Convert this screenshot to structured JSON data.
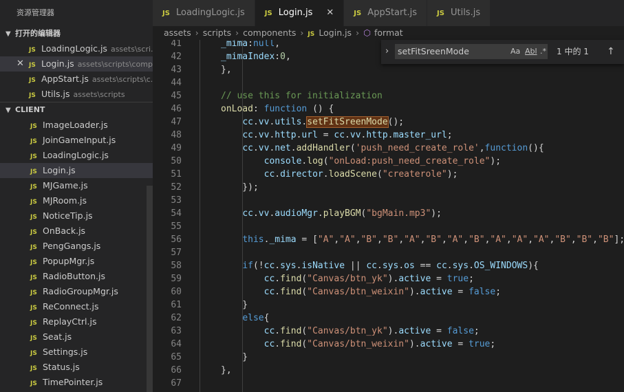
{
  "sidebar": {
    "title": "资源管理器",
    "open_editors_title": "打开的编辑器",
    "open_editors": [
      {
        "name": "LoadingLogic.js",
        "path": "assets\\scri...",
        "selected": false,
        "close": false
      },
      {
        "name": "Login.js",
        "path": "assets\\scripts\\comp...",
        "selected": true,
        "close": true
      },
      {
        "name": "AppStart.js",
        "path": "assets\\scripts\\c...",
        "selected": false,
        "close": false
      },
      {
        "name": "Utils.js",
        "path": "assets\\scripts",
        "selected": false,
        "close": false
      }
    ],
    "client_title": "CLIENT",
    "files": [
      "ImageLoader.js",
      "JoinGameInput.js",
      "LoadingLogic.js",
      "Login.js",
      "MJGame.js",
      "MJRoom.js",
      "NoticeTip.js",
      "OnBack.js",
      "PengGangs.js",
      "PopupMgr.js",
      "RadioButton.js",
      "RadioGroupMgr.js",
      "ReConnect.js",
      "ReplayCtrl.js",
      "Seat.js",
      "Settings.js",
      "Status.js",
      "TimePointer.js"
    ],
    "selected_file": "Login.js"
  },
  "tabs": [
    {
      "label": "LoadingLogic.js",
      "active": false
    },
    {
      "label": "Login.js",
      "active": true
    },
    {
      "label": "AppStart.js",
      "active": false
    },
    {
      "label": "Utils.js",
      "active": false
    }
  ],
  "breadcrumb": {
    "parts": [
      "assets",
      "scripts",
      "components",
      "Login.js"
    ],
    "symbol": "format"
  },
  "find": {
    "query": "setFitSreenMode",
    "opt_case": "Aa",
    "opt_word": "Abl",
    "opt_regex": ".*",
    "count": "1 中的 1"
  },
  "code": {
    "lines": [
      {
        "n": "41",
        "t": [
          [
            "p",
            "_mima"
          ],
          [
            "d",
            ":"
          ],
          [
            "k",
            "null"
          ],
          [
            "d",
            ","
          ]
        ]
      },
      {
        "n": "42",
        "t": [
          [
            "p",
            "_mimaIndex"
          ],
          [
            "d",
            ":"
          ],
          [
            "n",
            "0"
          ],
          [
            "d",
            ","
          ]
        ]
      },
      {
        "n": "43",
        "t": [
          [
            "d",
            "},"
          ]
        ]
      },
      {
        "n": "44",
        "t": []
      },
      {
        "n": "45",
        "t": [
          [
            "c",
            "// use this for initialization"
          ]
        ]
      },
      {
        "n": "46",
        "t": [
          [
            "f",
            "onLoad"
          ],
          [
            "d",
            ": "
          ],
          [
            "k",
            "function"
          ],
          [
            "d",
            " () {"
          ]
        ]
      },
      {
        "n": "47",
        "t": [
          [
            "d",
            "    "
          ],
          [
            "p",
            "cc"
          ],
          [
            "d",
            "."
          ],
          [
            "p",
            "vv"
          ],
          [
            "d",
            "."
          ],
          [
            "p",
            "utils"
          ],
          [
            "d",
            "."
          ],
          [
            "h",
            "setFitSreenMode"
          ],
          [
            "d",
            "();"
          ]
        ]
      },
      {
        "n": "48",
        "t": [
          [
            "d",
            "    "
          ],
          [
            "p",
            "cc"
          ],
          [
            "d",
            "."
          ],
          [
            "p",
            "vv"
          ],
          [
            "d",
            "."
          ],
          [
            "p",
            "http"
          ],
          [
            "d",
            "."
          ],
          [
            "p",
            "url"
          ],
          [
            "d",
            " = "
          ],
          [
            "p",
            "cc"
          ],
          [
            "d",
            "."
          ],
          [
            "p",
            "vv"
          ],
          [
            "d",
            "."
          ],
          [
            "p",
            "http"
          ],
          [
            "d",
            "."
          ],
          [
            "p",
            "master_url"
          ],
          [
            "d",
            ";"
          ]
        ]
      },
      {
        "n": "49",
        "t": [
          [
            "d",
            "    "
          ],
          [
            "p",
            "cc"
          ],
          [
            "d",
            "."
          ],
          [
            "p",
            "vv"
          ],
          [
            "d",
            "."
          ],
          [
            "p",
            "net"
          ],
          [
            "d",
            "."
          ],
          [
            "f",
            "addHandler"
          ],
          [
            "d",
            "("
          ],
          [
            "s",
            "'push_need_create_role'"
          ],
          [
            "d",
            ","
          ],
          [
            "k",
            "function"
          ],
          [
            "d",
            "(){"
          ]
        ]
      },
      {
        "n": "50",
        "t": [
          [
            "d",
            "        "
          ],
          [
            "p",
            "console"
          ],
          [
            "d",
            "."
          ],
          [
            "f",
            "log"
          ],
          [
            "d",
            "("
          ],
          [
            "s",
            "\"onLoad:push_need_create_role\""
          ],
          [
            "d",
            ");"
          ]
        ]
      },
      {
        "n": "51",
        "t": [
          [
            "d",
            "        "
          ],
          [
            "p",
            "cc"
          ],
          [
            "d",
            "."
          ],
          [
            "p",
            "director"
          ],
          [
            "d",
            "."
          ],
          [
            "f",
            "loadScene"
          ],
          [
            "d",
            "("
          ],
          [
            "s",
            "\"createrole\""
          ],
          [
            "d",
            ");"
          ]
        ]
      },
      {
        "n": "52",
        "t": [
          [
            "d",
            "    });"
          ]
        ]
      },
      {
        "n": "53",
        "t": []
      },
      {
        "n": "54",
        "t": [
          [
            "d",
            "    "
          ],
          [
            "p",
            "cc"
          ],
          [
            "d",
            "."
          ],
          [
            "p",
            "vv"
          ],
          [
            "d",
            "."
          ],
          [
            "p",
            "audioMgr"
          ],
          [
            "d",
            "."
          ],
          [
            "f",
            "playBGM"
          ],
          [
            "d",
            "("
          ],
          [
            "s",
            "\"bgMain.mp3\""
          ],
          [
            "d",
            ");"
          ]
        ]
      },
      {
        "n": "55",
        "t": []
      },
      {
        "n": "56",
        "t": [
          [
            "d",
            "    "
          ],
          [
            "k",
            "this"
          ],
          [
            "d",
            "."
          ],
          [
            "p",
            "_mima"
          ],
          [
            "d",
            " = ["
          ],
          [
            "s",
            "\"A\""
          ],
          [
            "d",
            ","
          ],
          [
            "s",
            "\"A\""
          ],
          [
            "d",
            ","
          ],
          [
            "s",
            "\"B\""
          ],
          [
            "d",
            ","
          ],
          [
            "s",
            "\"B\""
          ],
          [
            "d",
            ","
          ],
          [
            "s",
            "\"A\""
          ],
          [
            "d",
            ","
          ],
          [
            "s",
            "\"B\""
          ],
          [
            "d",
            ","
          ],
          [
            "s",
            "\"A\""
          ],
          [
            "d",
            ","
          ],
          [
            "s",
            "\"B\""
          ],
          [
            "d",
            ","
          ],
          [
            "s",
            "\"A\""
          ],
          [
            "d",
            ","
          ],
          [
            "s",
            "\"A\""
          ],
          [
            "d",
            ","
          ],
          [
            "s",
            "\"A\""
          ],
          [
            "d",
            ","
          ],
          [
            "s",
            "\"B\""
          ],
          [
            "d",
            ","
          ],
          [
            "s",
            "\"B\""
          ],
          [
            "d",
            ","
          ],
          [
            "s",
            "\"B\""
          ],
          [
            "d",
            "];"
          ]
        ]
      },
      {
        "n": "57",
        "t": []
      },
      {
        "n": "58",
        "t": [
          [
            "d",
            "    "
          ],
          [
            "k",
            "if"
          ],
          [
            "d",
            "(!"
          ],
          [
            "p",
            "cc"
          ],
          [
            "d",
            "."
          ],
          [
            "p",
            "sys"
          ],
          [
            "d",
            "."
          ],
          [
            "p",
            "isNative"
          ],
          [
            "d",
            " || "
          ],
          [
            "p",
            "cc"
          ],
          [
            "d",
            "."
          ],
          [
            "p",
            "sys"
          ],
          [
            "d",
            "."
          ],
          [
            "p",
            "os"
          ],
          [
            "d",
            " == "
          ],
          [
            "p",
            "cc"
          ],
          [
            "d",
            "."
          ],
          [
            "p",
            "sys"
          ],
          [
            "d",
            "."
          ],
          [
            "p",
            "OS_WINDOWS"
          ],
          [
            "d",
            "){"
          ]
        ]
      },
      {
        "n": "59",
        "t": [
          [
            "d",
            "        "
          ],
          [
            "p",
            "cc"
          ],
          [
            "d",
            "."
          ],
          [
            "f",
            "find"
          ],
          [
            "d",
            "("
          ],
          [
            "s",
            "\"Canvas/btn_yk\""
          ],
          [
            "d",
            ")."
          ],
          [
            "p",
            "active"
          ],
          [
            "d",
            " = "
          ],
          [
            "k",
            "true"
          ],
          [
            "d",
            ";"
          ]
        ]
      },
      {
        "n": "60",
        "t": [
          [
            "d",
            "        "
          ],
          [
            "p",
            "cc"
          ],
          [
            "d",
            "."
          ],
          [
            "f",
            "find"
          ],
          [
            "d",
            "("
          ],
          [
            "s",
            "\"Canvas/btn_weixin\""
          ],
          [
            "d",
            ")."
          ],
          [
            "p",
            "active"
          ],
          [
            "d",
            " = "
          ],
          [
            "k",
            "false"
          ],
          [
            "d",
            ";"
          ]
        ]
      },
      {
        "n": "61",
        "t": [
          [
            "d",
            "    }"
          ]
        ]
      },
      {
        "n": "62",
        "t": [
          [
            "d",
            "    "
          ],
          [
            "k",
            "else"
          ],
          [
            "d",
            "{"
          ]
        ]
      },
      {
        "n": "63",
        "t": [
          [
            "d",
            "        "
          ],
          [
            "p",
            "cc"
          ],
          [
            "d",
            "."
          ],
          [
            "f",
            "find"
          ],
          [
            "d",
            "("
          ],
          [
            "s",
            "\"Canvas/btn_yk\""
          ],
          [
            "d",
            ")."
          ],
          [
            "p",
            "active"
          ],
          [
            "d",
            " = "
          ],
          [
            "k",
            "false"
          ],
          [
            "d",
            ";"
          ]
        ]
      },
      {
        "n": "64",
        "t": [
          [
            "d",
            "        "
          ],
          [
            "p",
            "cc"
          ],
          [
            "d",
            "."
          ],
          [
            "f",
            "find"
          ],
          [
            "d",
            "("
          ],
          [
            "s",
            "\"Canvas/btn_weixin\""
          ],
          [
            "d",
            ")."
          ],
          [
            "p",
            "active"
          ],
          [
            "d",
            " = "
          ],
          [
            "k",
            "true"
          ],
          [
            "d",
            ";"
          ]
        ]
      },
      {
        "n": "65",
        "t": [
          [
            "d",
            "    }"
          ]
        ]
      },
      {
        "n": "66",
        "t": [
          [
            "d",
            "},"
          ]
        ]
      },
      {
        "n": "67",
        "t": []
      }
    ]
  }
}
